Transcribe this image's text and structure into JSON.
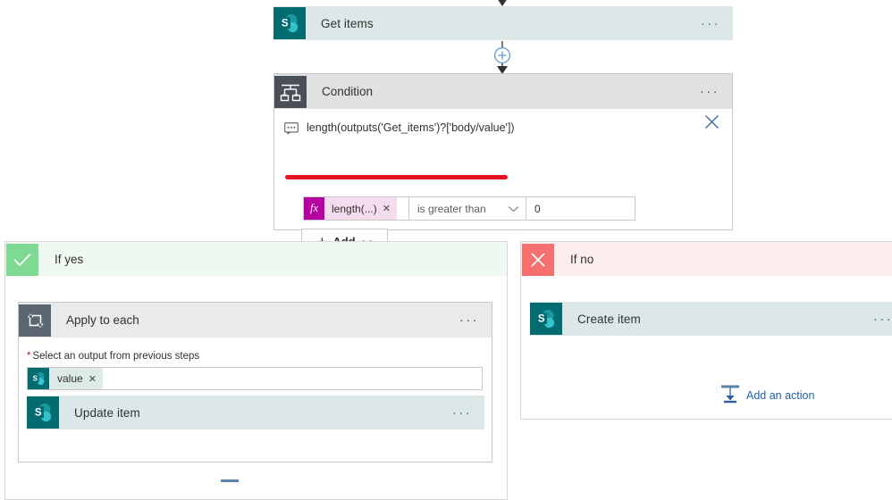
{
  "flow": {
    "get_items": {
      "title": "Get items",
      "icon": "sharepoint-icon",
      "more_label": "···",
      "accent": "#036c70",
      "card_bg": "#dce8e8"
    },
    "connector": {
      "insert_label": "+",
      "insert_color": "#5b9bd5"
    },
    "condition": {
      "title": "Condition",
      "icon": "condition-branch-icon",
      "more_label": "···",
      "expression": "length(outputs('Get_items')?['body/value'])",
      "comment_icon": "comment-icon",
      "close_label": "✕",
      "error_bar_color": "#e81123",
      "row": {
        "token_prefix": "fx",
        "token_label": "length(...)",
        "token_remove": "✕",
        "operator": "is greater than",
        "operator_chevron": "chevron-down-icon",
        "value": "0"
      },
      "add_button": {
        "plus": "+",
        "label": "Add",
        "chevron": "chevron-down-icon"
      }
    },
    "branches": [
      {
        "key": "if_yes",
        "title": "If yes",
        "badge_icon": "checkmark-icon",
        "badge_glyph": "✓",
        "badge_color": "#7ed992",
        "header_bg": "#eff9f1",
        "apply_to_each": {
          "title": "Apply to each",
          "icon": "loop-icon",
          "more_label": "···",
          "field_label": "Select an output from previous steps",
          "required_marker": "*",
          "token": {
            "icon": "sharepoint-icon",
            "label": "value",
            "remove": "✕"
          },
          "inner_action": {
            "title": "Update item",
            "icon": "sharepoint-icon",
            "more_label": "···"
          }
        }
      },
      {
        "key": "if_no",
        "title": "If no",
        "badge_icon": "close-icon",
        "badge_glyph": "✕",
        "badge_color": "#f5706e",
        "header_bg": "#fdeeee",
        "action": {
          "title": "Create item",
          "icon": "sharepoint-icon",
          "more_label": "···"
        },
        "add_an_action": {
          "label": "Add an action",
          "icon": "add-action-icon",
          "color": "#1f5fa9"
        }
      }
    ]
  }
}
